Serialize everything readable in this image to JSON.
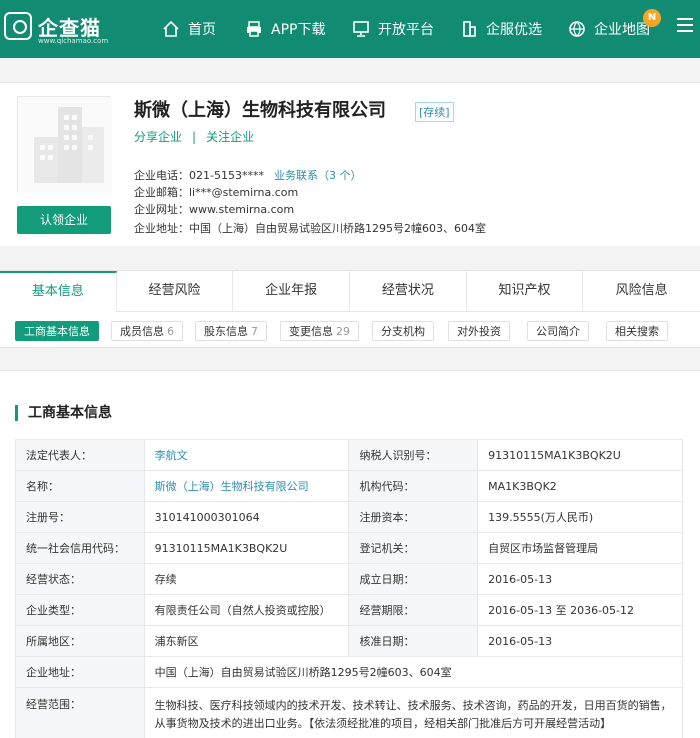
{
  "header": {
    "logo_text": "企查猫",
    "logo_sub": "www.qichamao.com",
    "nav": [
      {
        "label": "首页",
        "icon": "home-icon"
      },
      {
        "label": "APP下载",
        "icon": "printer-icon"
      },
      {
        "label": "开放平台",
        "icon": "monitor-icon"
      },
      {
        "label": "企服优选",
        "icon": "building-icon"
      },
      {
        "label": "企业地图",
        "icon": "globe-icon"
      }
    ],
    "badge": "N"
  },
  "company": {
    "name": "斯微（上海）生物科技有限公司",
    "status": "[存续]",
    "share": "分享企业",
    "sep": "|",
    "follow": "关注企业",
    "claim": "认领企业",
    "phone_label": "企业电话：",
    "phone": "021-5153****",
    "contact_link": "业务联系（3 个）",
    "email_label": "企业邮箱：",
    "email": "li***@stemirna.com",
    "site_label": "企业网址：",
    "site": "www.stemirna.com",
    "addr_label": "企业地址：",
    "addr": "中国（上海）自由贸易试验区川桥路1295号2幢603、604室"
  },
  "tabs": [
    "基本信息",
    "经营风险",
    "企业年报",
    "经营状况",
    "知识产权",
    "风险信息"
  ],
  "subtabs": [
    {
      "label": "工商基本信息",
      "num": ""
    },
    {
      "label": "成员信息",
      "num": "6"
    },
    {
      "label": "股东信息",
      "num": "7"
    },
    {
      "label": "变更信息",
      "num": "29"
    },
    {
      "label": "分支机构",
      "num": ""
    },
    {
      "label": "对外投资",
      "num": ""
    },
    {
      "label": "公司简介",
      "num": ""
    },
    {
      "label": "相关搜索",
      "num": ""
    }
  ],
  "section": {
    "title": "工商基本信息",
    "rows": [
      [
        "法定代表人：",
        "李航文",
        "纳税人识别号：",
        "91310115MA1K3BQK2U"
      ],
      [
        "名称：",
        "斯微（上海）生物科技有限公司",
        "机构代码：",
        "MA1K3BQK2"
      ],
      [
        "注册号：",
        "310141000301064",
        "注册资本：",
        "139.5555(万人民币)"
      ],
      [
        "统一社会信用代码：",
        "91310115MA1K3BQK2U",
        "登记机关：",
        "自贸区市场监督管理局"
      ],
      [
        "经营状态：",
        "存续",
        "成立日期：",
        "2016-05-13"
      ],
      [
        "企业类型：",
        "有限责任公司（自然人投资或控股）",
        "经营期限：",
        "2016-05-13 至 2036-05-12"
      ],
      [
        "所属地区：",
        "浦东新区",
        "核准日期：",
        "2016-05-13"
      ]
    ],
    "address_label": "企业地址：",
    "address": "中国（上海）自由贸易试验区川桥路1295号2幢603、604室",
    "scope_label": "经营范围：",
    "scope": "生物科技、医疗科技领域内的技术开发、技术转让、技术服务、技术咨询，药品的开发，日用百货的销售，从事货物及技术的进出口业务。【依法须经批准的项目，经相关部门批准后方可开展经营活动】"
  }
}
